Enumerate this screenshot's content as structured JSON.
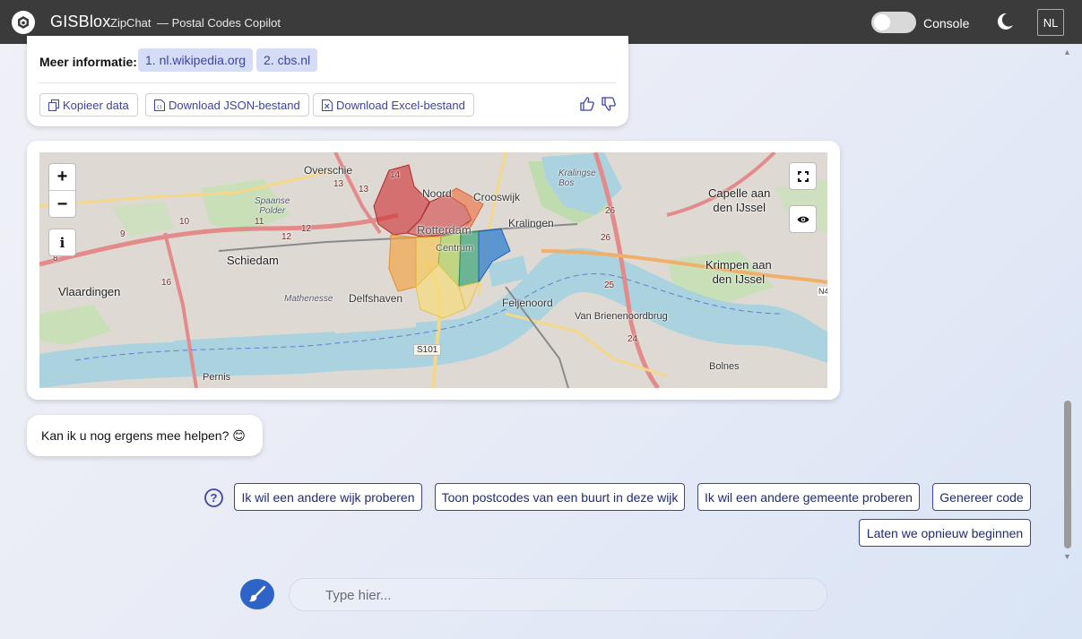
{
  "header": {
    "brand": "GISBlox",
    "app_name": "ZipChat",
    "subtitle": "— Postal Codes Copilot",
    "console_label": "Console",
    "console_on": false,
    "language": "NL"
  },
  "info_card": {
    "more_info_label": "Meer informatie:",
    "links": [
      "1. nl.wikipedia.org",
      "2. cbs.nl"
    ],
    "actions": {
      "copy": "Kopieer data",
      "json": "Download JSON-bestand",
      "excel": "Download Excel-bestand"
    }
  },
  "map": {
    "zoom_in": "+",
    "zoom_out": "−",
    "info": "i",
    "labels": {
      "overschie": "Overschie",
      "noord": "Noord",
      "crooswijk": "Crooswijk",
      "kralingse_bos": "Kralingse\nBos",
      "capelle": "Capelle aan\nden IJssel",
      "spaanse_polder": "Spaanse\nPolder",
      "kralingen": "Kralingen",
      "rotterdam": "Rotterdam",
      "centrum": "Centrum",
      "schiedam": "Schiedam",
      "krimpen": "Krimpen aan\nden IJssel",
      "vlaardingen": "Vlaardingen",
      "mathenesse": "Mathenesse",
      "delfshaven": "Delfshaven",
      "feijenoord": "Feijenoord",
      "brug": "Van Brienenoordbrug",
      "s101": "S101",
      "bolnes": "Bolnes",
      "pernis": "Pernis",
      "n_edge": "N4"
    },
    "road_numbers": [
      "14",
      "13",
      "13",
      "11",
      "10",
      "9",
      "8",
      "12",
      "12",
      "16",
      "26",
      "26",
      "25",
      "24",
      "16"
    ]
  },
  "chat": {
    "question": "Kan ik u nog ergens mee helpen? 😊"
  },
  "suggestions": [
    "Ik wil een andere wijk proberen",
    "Toon postcodes van een buurt in deze wijk",
    "Ik wil een andere gemeente proberen",
    "Genereer code",
    "Laten we opnieuw beginnen"
  ],
  "input": {
    "placeholder": "Type hier..."
  },
  "colors": {
    "accent": "#3b44a8",
    "topbar": "#3b3b3b",
    "send_button": "#2e63c8"
  }
}
